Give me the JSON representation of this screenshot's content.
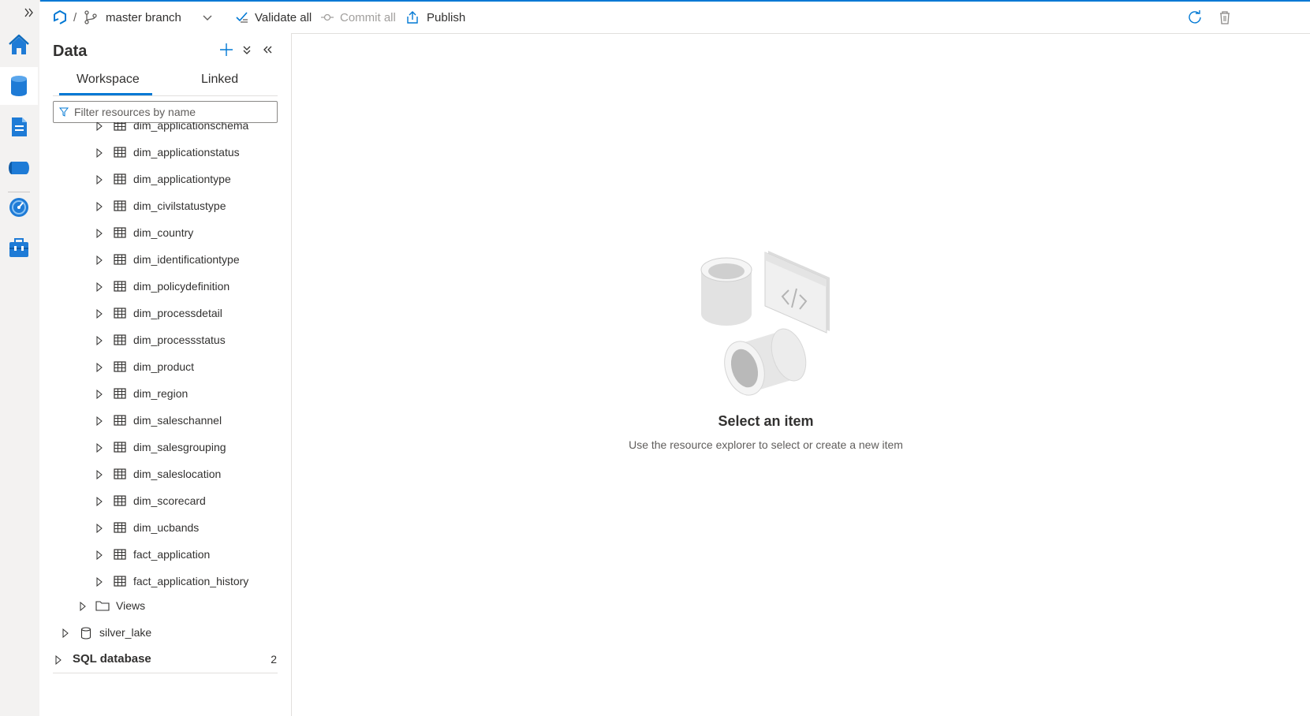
{
  "toolbar": {
    "branch": "master branch",
    "validate_all": "Validate all",
    "commit_all": "Commit all",
    "publish": "Publish"
  },
  "nav": {
    "items": [
      "home-icon",
      "data-icon",
      "develop-icon",
      "integrate-icon",
      "monitor-icon",
      "manage-icon"
    ],
    "active": "data-icon"
  },
  "panel": {
    "title": "Data",
    "tabs": [
      "Workspace",
      "Linked"
    ],
    "active_tab": "Workspace",
    "filter_placeholder": "Filter resources by name",
    "partial_row": "dim_applicationschema",
    "tables": [
      "dim_applicationstatus",
      "dim_applicationtype",
      "dim_civilstatustype",
      "dim_country",
      "dim_identificationtype",
      "dim_policydefinition",
      "dim_processdetail",
      "dim_processstatus",
      "dim_product",
      "dim_region",
      "dim_saleschannel",
      "dim_salesgrouping",
      "dim_saleslocation",
      "dim_scorecard",
      "dim_ucbands",
      "fact_application",
      "fact_application_history"
    ],
    "views_label": "Views",
    "database_label": "silver_lake",
    "section_label": "SQL database",
    "section_count": "2"
  },
  "empty_state": {
    "title": "Select an item",
    "subtitle": "Use the resource explorer to select or create a new item"
  },
  "colors": {
    "accent": "#0078d4",
    "nav_bg": "#f3f2f1"
  }
}
